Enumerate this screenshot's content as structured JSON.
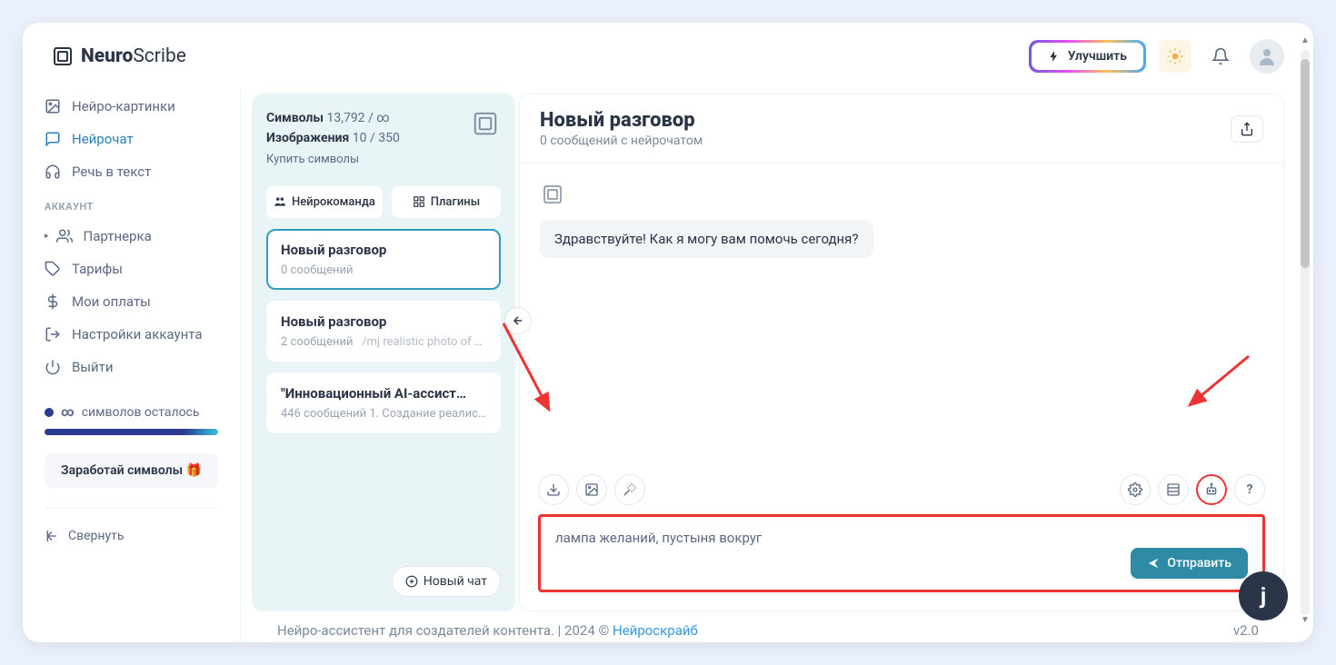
{
  "logo": {
    "bold": "Neuro",
    "light": "Scribe"
  },
  "header": {
    "upgrade": "Улучшить"
  },
  "sidebar": {
    "nav1": [
      {
        "label": "Нейро-картинки",
        "icon": "image"
      },
      {
        "label": "Нейрочат",
        "icon": "chat",
        "active": true
      },
      {
        "label": "Речь в текст",
        "icon": "headphones"
      }
    ],
    "account_label": "АККАУНТ",
    "nav2": [
      {
        "label": "Партнерка",
        "icon": "users",
        "expandable": true
      },
      {
        "label": "Тарифы",
        "icon": "tag"
      },
      {
        "label": "Мои оплаты",
        "icon": "dollar"
      },
      {
        "label": "Настройки аккаунта",
        "icon": "logout"
      },
      {
        "label": "Выйти",
        "icon": "power"
      }
    ],
    "symbols_left": "символов осталось",
    "earn": "Заработай символы 🎁",
    "collapse": "Свернуть"
  },
  "stats": {
    "symbols_label": "Символы",
    "symbols_value": "13,792 / ∞",
    "images_label": "Изображения",
    "images_value": "10 / 350",
    "buy": "Купить символы"
  },
  "pills": {
    "team": "Нейрокоманда",
    "plugins": "Плагины"
  },
  "conversations": [
    {
      "title": "Новый разговор",
      "meta": "0 сообщений",
      "active": true
    },
    {
      "title": "Новый разговор",
      "meta": "2 сообщений",
      "meta2": "/mj realistic photo of a…"
    },
    {
      "title": "\"Инновационный AI-ассист…",
      "meta": "446 сообщений 1. Создание реалисти…"
    }
  ],
  "new_chat": "Новый чат",
  "chat": {
    "title": "Новый разговор",
    "subtitle": "0 сообщений с нейрочатом",
    "greeting": "Здравствуйте! Как я могу вам помочь сегодня?"
  },
  "input": {
    "text": "лампа желаний, пустыня вокруг",
    "send": "Отправить"
  },
  "footer": {
    "text_left": "Нейро-ассистент для создателей контента.  | 2024 © ",
    "link": "Нейроскрайб",
    "version": "v2.0"
  },
  "widget": "j"
}
